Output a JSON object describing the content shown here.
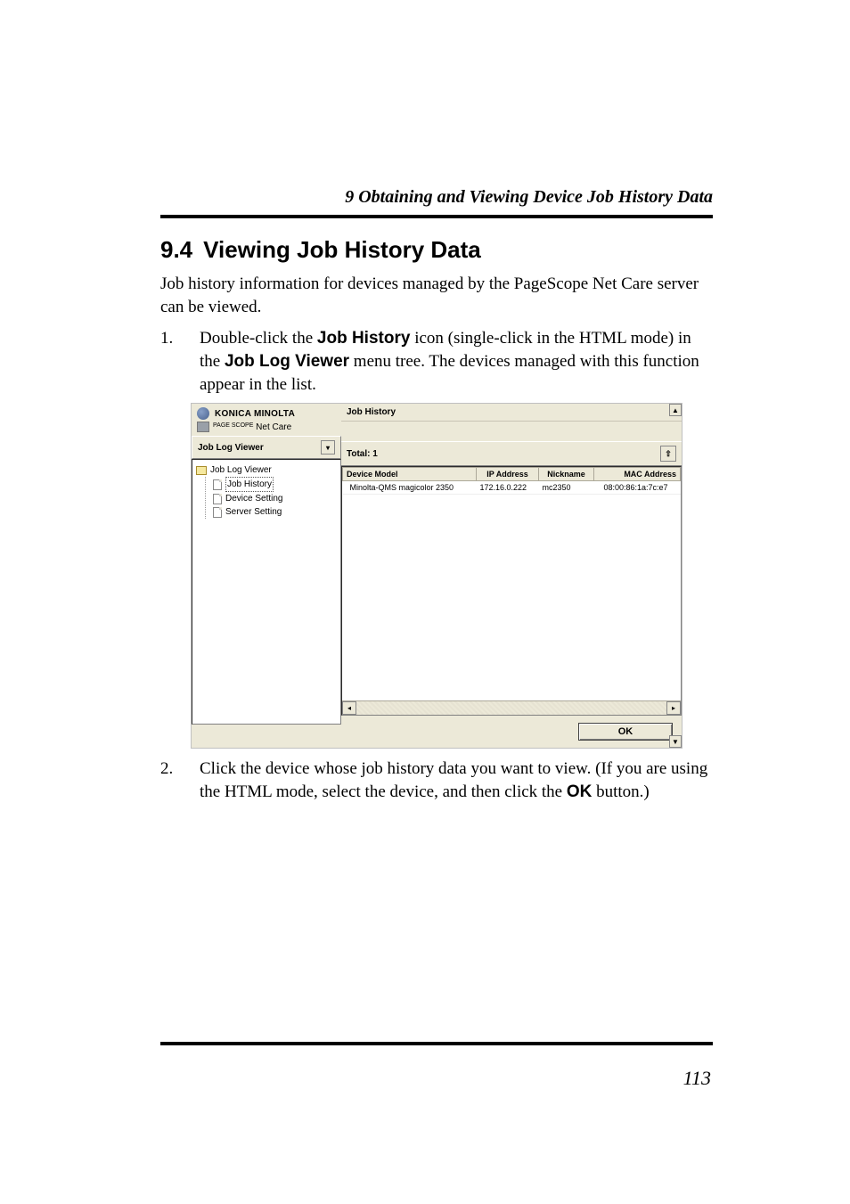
{
  "running_head": "9  Obtaining and Viewing Device Job History Data",
  "section": {
    "number": "9.4",
    "title": "Viewing Job History Data"
  },
  "intro": "Job history information for devices managed by the PageScope Net Care server can be viewed.",
  "steps": [
    {
      "num": "1.",
      "pre": "Double-click the ",
      "bold1": "Job History",
      "mid1": " icon (single-click in the HTML mode) in the ",
      "bold2": "Job Log Viewer",
      "post": " menu tree. The devices managed with this function appear in the list."
    },
    {
      "num": "2.",
      "pre": "Click the device whose job history data you want to view. (If you are using the HTML mode, select the device, and then click the ",
      "bold1": "OK",
      "post": " button.)"
    }
  ],
  "screenshot": {
    "brand": "KONICA MINOLTA",
    "subbrand_small": "PAGE\nSCOPE",
    "subbrand": "Net Care",
    "menu_label": "Job Log Viewer",
    "tree": {
      "root": "Job Log Viewer",
      "children": [
        "Job History",
        "Device Setting",
        "Server Setting"
      ],
      "selected_index": 0
    },
    "panel_title": "Job History",
    "total_label": "Total: 1",
    "columns": [
      "Device Model",
      "IP Address",
      "Nickname",
      "MAC Address"
    ],
    "rows": [
      {
        "model": "Minolta-QMS magicolor 2350",
        "ip": "172.16.0.222",
        "nickname": "mc2350",
        "mac": "08:00:86:1a:7c:e7"
      }
    ],
    "ok_label": "OK"
  },
  "page_number": "113"
}
